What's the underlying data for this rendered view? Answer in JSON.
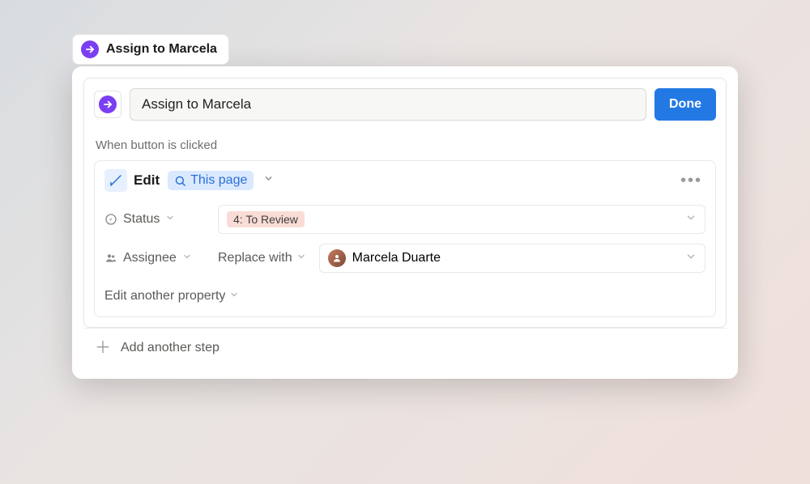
{
  "tab": {
    "label": "Assign to Marcela"
  },
  "editor": {
    "title_value": "Assign to Marcela",
    "done_label": "Done",
    "trigger_label": "When button is clicked"
  },
  "step": {
    "action_label": "Edit",
    "target_label": "This page",
    "properties": {
      "status": {
        "label": "Status",
        "value": "4: To Review"
      },
      "assignee": {
        "label": "Assignee",
        "operation": "Replace with",
        "value": "Marcela Duarte"
      }
    },
    "edit_another_label": "Edit another property"
  },
  "footer": {
    "add_step_label": "Add another step"
  }
}
